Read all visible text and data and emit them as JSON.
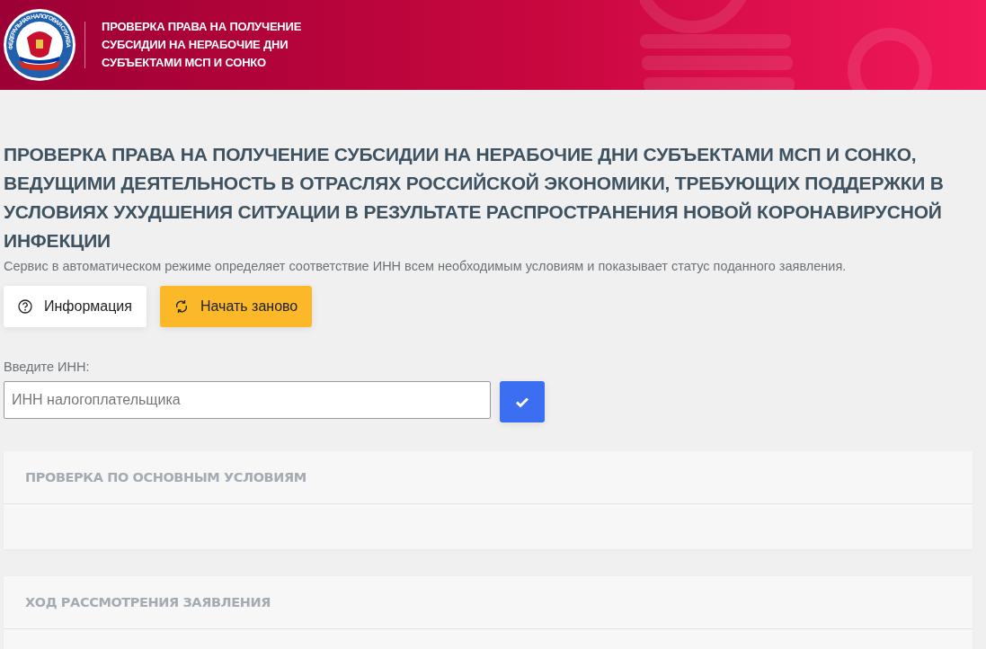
{
  "header": {
    "logo_text": "ФЕДЕРАЛЬНАЯ НАЛОГОВАЯ СЛУЖБА",
    "title": "ПРОВЕРКА ПРАВА НА ПОЛУЧЕНИЕ СУБСИДИИ НА НЕРАБОЧИЕ ДНИ СУБЪЕКТАМИ МСП И СОНКО"
  },
  "page_title": "ПРОВЕРКА ПРАВА НА ПОЛУЧЕНИЕ СУБСИДИИ НА НЕРАБОЧИЕ ДНИ СУБЪЕКТАМИ МСП И СОНКО, ВЕДУЩИМИ ДЕЯТЕЛЬНОСТЬ В ОТРАСЛЯХ РОССИЙСКОЙ ЭКОНОМИКИ, ТРЕБУЮЩИХ ПОДДЕРЖКИ В УСЛОВИЯХ УХУДШЕНИЯ СИТУАЦИИ В РЕЗУЛЬТАТЕ РАСПРОСТРАНЕНИЯ НОВОЙ КОРОНАВИРУСНОЙ ИНФЕКЦИИ",
  "description": "Сервис в автоматическом режиме определяет соответствие ИНН всем необходимым условиям и показывает статус поданного заявления.",
  "buttons": [
    {
      "kind": "info",
      "label": "Информация"
    },
    {
      "kind": "restart",
      "label": "Начать заново"
    }
  ],
  "inn": {
    "label": "Введите ИНН:",
    "placeholder": "ИНН налогоплательщика"
  },
  "panels": [
    {
      "title": "ПРОВЕРКА ПО ОСНОВНЫМ УСЛОВИЯМ"
    },
    {
      "title": "ХОД РАССМОТРЕНИЯ ЗАЯВЛЕНИЯ"
    }
  ]
}
